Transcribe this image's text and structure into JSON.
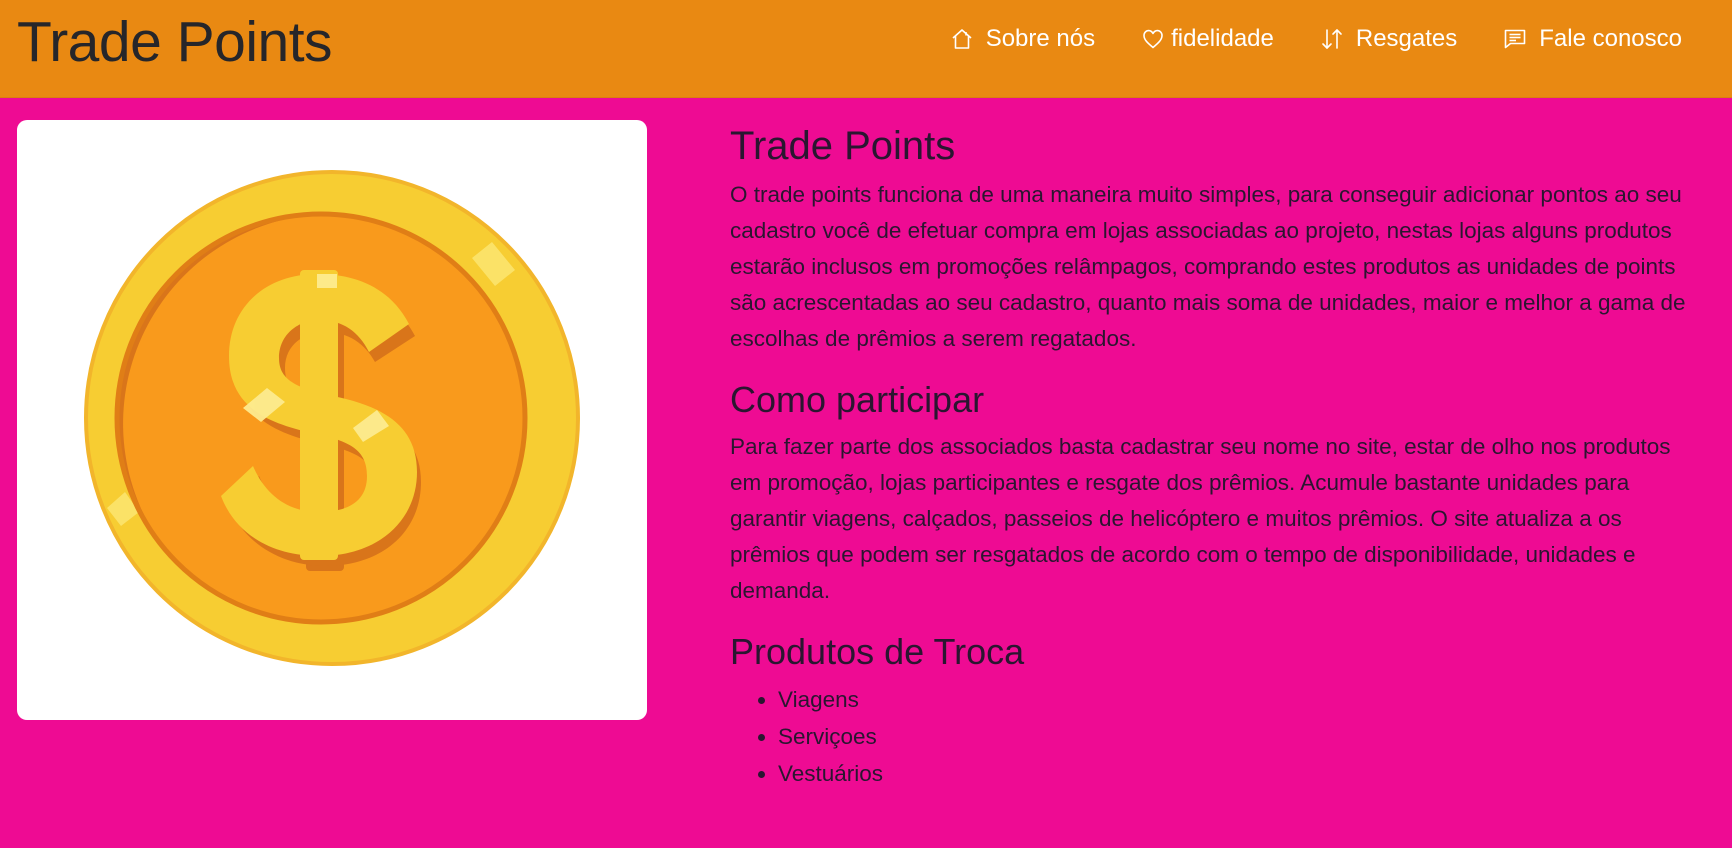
{
  "navbar": {
    "brand": "Trade Points",
    "links": [
      {
        "label": "Sobre nós",
        "icon": "house-icon"
      },
      {
        "label": "fidelidade",
        "icon": "heart-icon"
      },
      {
        "label": "Resgates",
        "icon": "arrows-up-down-icon"
      },
      {
        "label": "Fale conosco",
        "icon": "chat-icon"
      }
    ],
    "colors": {
      "background": "#e98912",
      "link_text": "#ffffff"
    }
  },
  "image": {
    "icon": "gold-coin-dollar-icon"
  },
  "main": {
    "title": "Trade Points",
    "intro": "O trade points funciona de uma maneira muito simples, para conseguir adicionar pontos ao seu cadastro você de efetuar compra em lojas associadas ao projeto, nestas lojas alguns produtos estarão inclusos em promoções relâmpagos, comprando estes produtos as unidades de points são acrescentadas ao seu cadastro, quanto mais soma de unidades, maior e melhor a gama de escolhas de prêmios a serem regatados.",
    "participate_title": "Como participar",
    "participate_text": "Para fazer parte dos associados basta cadastrar seu nome no site, estar de olho nos produtos em promoção, lojas participantes e resgate dos prêmios. Acumule bastante unidades para garantir viagens, calçados, passeios de helicóptero e muitos prêmios. O site atualiza a os prêmios que podem ser resgatados de acordo com o tempo de disponibilidade, unidades e demanda.",
    "products_title": "Produtos de Troca",
    "products": [
      "Viagens",
      "Serviçoes",
      "Vestuários"
    ]
  },
  "colors": {
    "page_background": "#ee0b93",
    "coin_outer": "#f7cd32",
    "coin_inner": "#f99a1c"
  }
}
